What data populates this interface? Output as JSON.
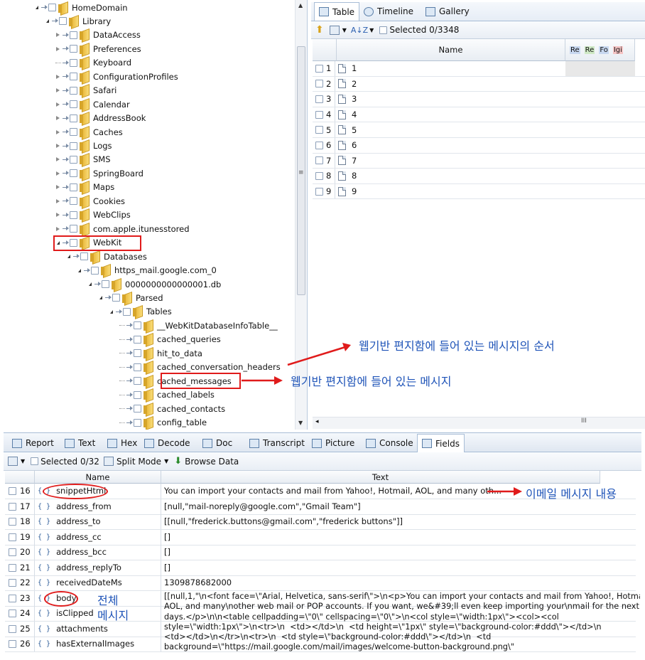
{
  "tree": {
    "nodes": [
      {
        "label": "HomeDomain",
        "toggle": "open",
        "level": 0
      },
      {
        "label": "Library",
        "toggle": "open",
        "level": 1
      },
      {
        "label": "DataAccess",
        "toggle": "closed",
        "level": 2
      },
      {
        "label": "Preferences",
        "toggle": "closed",
        "level": 2
      },
      {
        "label": "Keyboard",
        "toggle": "none",
        "level": 2
      },
      {
        "label": "ConfigurationProfiles",
        "toggle": "closed",
        "level": 2
      },
      {
        "label": "Safari",
        "toggle": "closed",
        "level": 2
      },
      {
        "label": "Calendar",
        "toggle": "closed",
        "level": 2
      },
      {
        "label": "AddressBook",
        "toggle": "closed",
        "level": 2
      },
      {
        "label": "Caches",
        "toggle": "closed",
        "level": 2
      },
      {
        "label": "Logs",
        "toggle": "closed",
        "level": 2
      },
      {
        "label": "SMS",
        "toggle": "closed",
        "level": 2
      },
      {
        "label": "SpringBoard",
        "toggle": "closed",
        "level": 2
      },
      {
        "label": "Maps",
        "toggle": "closed",
        "level": 2
      },
      {
        "label": "Cookies",
        "toggle": "closed",
        "level": 2
      },
      {
        "label": "WebClips",
        "toggle": "closed",
        "level": 2
      },
      {
        "label": "com.apple.itunesstored",
        "toggle": "closed",
        "level": 2
      },
      {
        "label": "WebKit",
        "toggle": "open",
        "level": 2
      },
      {
        "label": "Databases",
        "toggle": "open",
        "level": 3
      },
      {
        "label": "https_mail.google.com_0",
        "toggle": "open",
        "level": 4
      },
      {
        "label": "0000000000000001.db",
        "toggle": "open",
        "level": 5
      },
      {
        "label": "Parsed",
        "toggle": "open",
        "level": 6
      },
      {
        "label": "Tables",
        "toggle": "open",
        "level": 7
      },
      {
        "label": "__WebKitDatabaseInfoTable__",
        "toggle": "none",
        "level": 8
      },
      {
        "label": "cached_queries",
        "toggle": "none",
        "level": 8
      },
      {
        "label": "hit_to_data",
        "toggle": "none",
        "level": 8
      },
      {
        "label": "cached_conversation_headers",
        "toggle": "none",
        "level": 8
      },
      {
        "label": "cached_messages",
        "toggle": "none",
        "level": 8
      },
      {
        "label": "cached_labels",
        "toggle": "none",
        "level": 8
      },
      {
        "label": "cached_contacts",
        "toggle": "none",
        "level": 8
      },
      {
        "label": "config_table",
        "toggle": "none",
        "level": 8
      }
    ]
  },
  "right_tabs": {
    "table": "Table",
    "timeline": "Timeline",
    "gallery": "Gallery"
  },
  "right_toolbar": {
    "selected": "Selected 0/3348"
  },
  "grid": {
    "name_header": "Name",
    "extra_headers": [
      "Re",
      "Re",
      "Fo",
      "Igi"
    ],
    "rows": [
      {
        "num": "1",
        "name": "1"
      },
      {
        "num": "2",
        "name": "2"
      },
      {
        "num": "3",
        "name": "3"
      },
      {
        "num": "4",
        "name": "4"
      },
      {
        "num": "5",
        "name": "5"
      },
      {
        "num": "6",
        "name": "6"
      },
      {
        "num": "7",
        "name": "7"
      },
      {
        "num": "8",
        "name": "8"
      },
      {
        "num": "9",
        "name": "9"
      }
    ]
  },
  "bottom_tabs": [
    "Report",
    "Text",
    "Hex",
    "Decode",
    "Doc",
    "Transcript",
    "Picture",
    "Console",
    "Fields"
  ],
  "bottom_toolbar": {
    "selected": "Selected 0/32",
    "split": "Split Mode",
    "browse": "Browse Data"
  },
  "fields": {
    "name_header": "Name",
    "text_header": "Text",
    "rows": [
      {
        "num": "16",
        "name": "snippetHtml",
        "text": "You can import your contacts and mail from Yahoo!, Hotmail, AOL, and many oth..."
      },
      {
        "num": "17",
        "name": "address_from",
        "text": "[null,\"mail-noreply@google.com\",\"Gmail Team\"]"
      },
      {
        "num": "18",
        "name": "address_to",
        "text": "[[null,\"frederick.buttons@gmail.com\",\"frederick buttons\"]]"
      },
      {
        "num": "19",
        "name": "address_cc",
        "text": "[]"
      },
      {
        "num": "20",
        "name": "address_bcc",
        "text": "[]"
      },
      {
        "num": "21",
        "name": "address_replyTo",
        "text": "[]"
      },
      {
        "num": "22",
        "name": "receivedDateMs",
        "text": "1309878682000"
      },
      {
        "num": "23",
        "name": "body",
        "text": ""
      },
      {
        "num": "24",
        "name": "isClipped",
        "text": ""
      },
      {
        "num": "25",
        "name": "attachments",
        "text": ""
      },
      {
        "num": "26",
        "name": "hasExternalImages",
        "text": ""
      }
    ],
    "body_text": [
      "[[null,1,\"\\n<font face=\\\"Arial, Helvetica, sans-serif\\\">\\n<p>You can import your contacts and mail from Yahoo!, Hotmail,",
      "AOL, and many\\nother web mail or POP accounts. If you want, we&#39;ll even keep importing your\\nmail for the next 30",
      "days.</p>\\n\\n<table cellpadding=\\\"0\\\" cellspacing=\\\"0\\\">\\n<col style=\\\"width:1px\\\"><col><col",
      "style=\\\"width:1px\\\">\\n<tr>\\n  <td></td>\\n  <td height=\\\"1px\\\" style=\\\"background-color:#ddd\\\"></td>\\n",
      "<td></td>\\n</tr>\\n<tr>\\n  <td style=\\\"background-color:#ddd\\\"></td>\\n  <td",
      "background=\\\"https://mail.google.com/mail/images/welcome-button-background.png\\\""
    ]
  },
  "annotations": {
    "order": "웹기반 편지함에 들어 있는 메시지의 순서",
    "messages": "웹기반 편지함에 들어 있는 메시지",
    "email_content": "이메일 메시지 내용",
    "full_line1": "전체",
    "full_line2": "메시지"
  },
  "colors": {
    "annotation_blue": "#1f54b8",
    "highlight_red": "#e01b1b",
    "folder_yellow": "#e9b838"
  }
}
